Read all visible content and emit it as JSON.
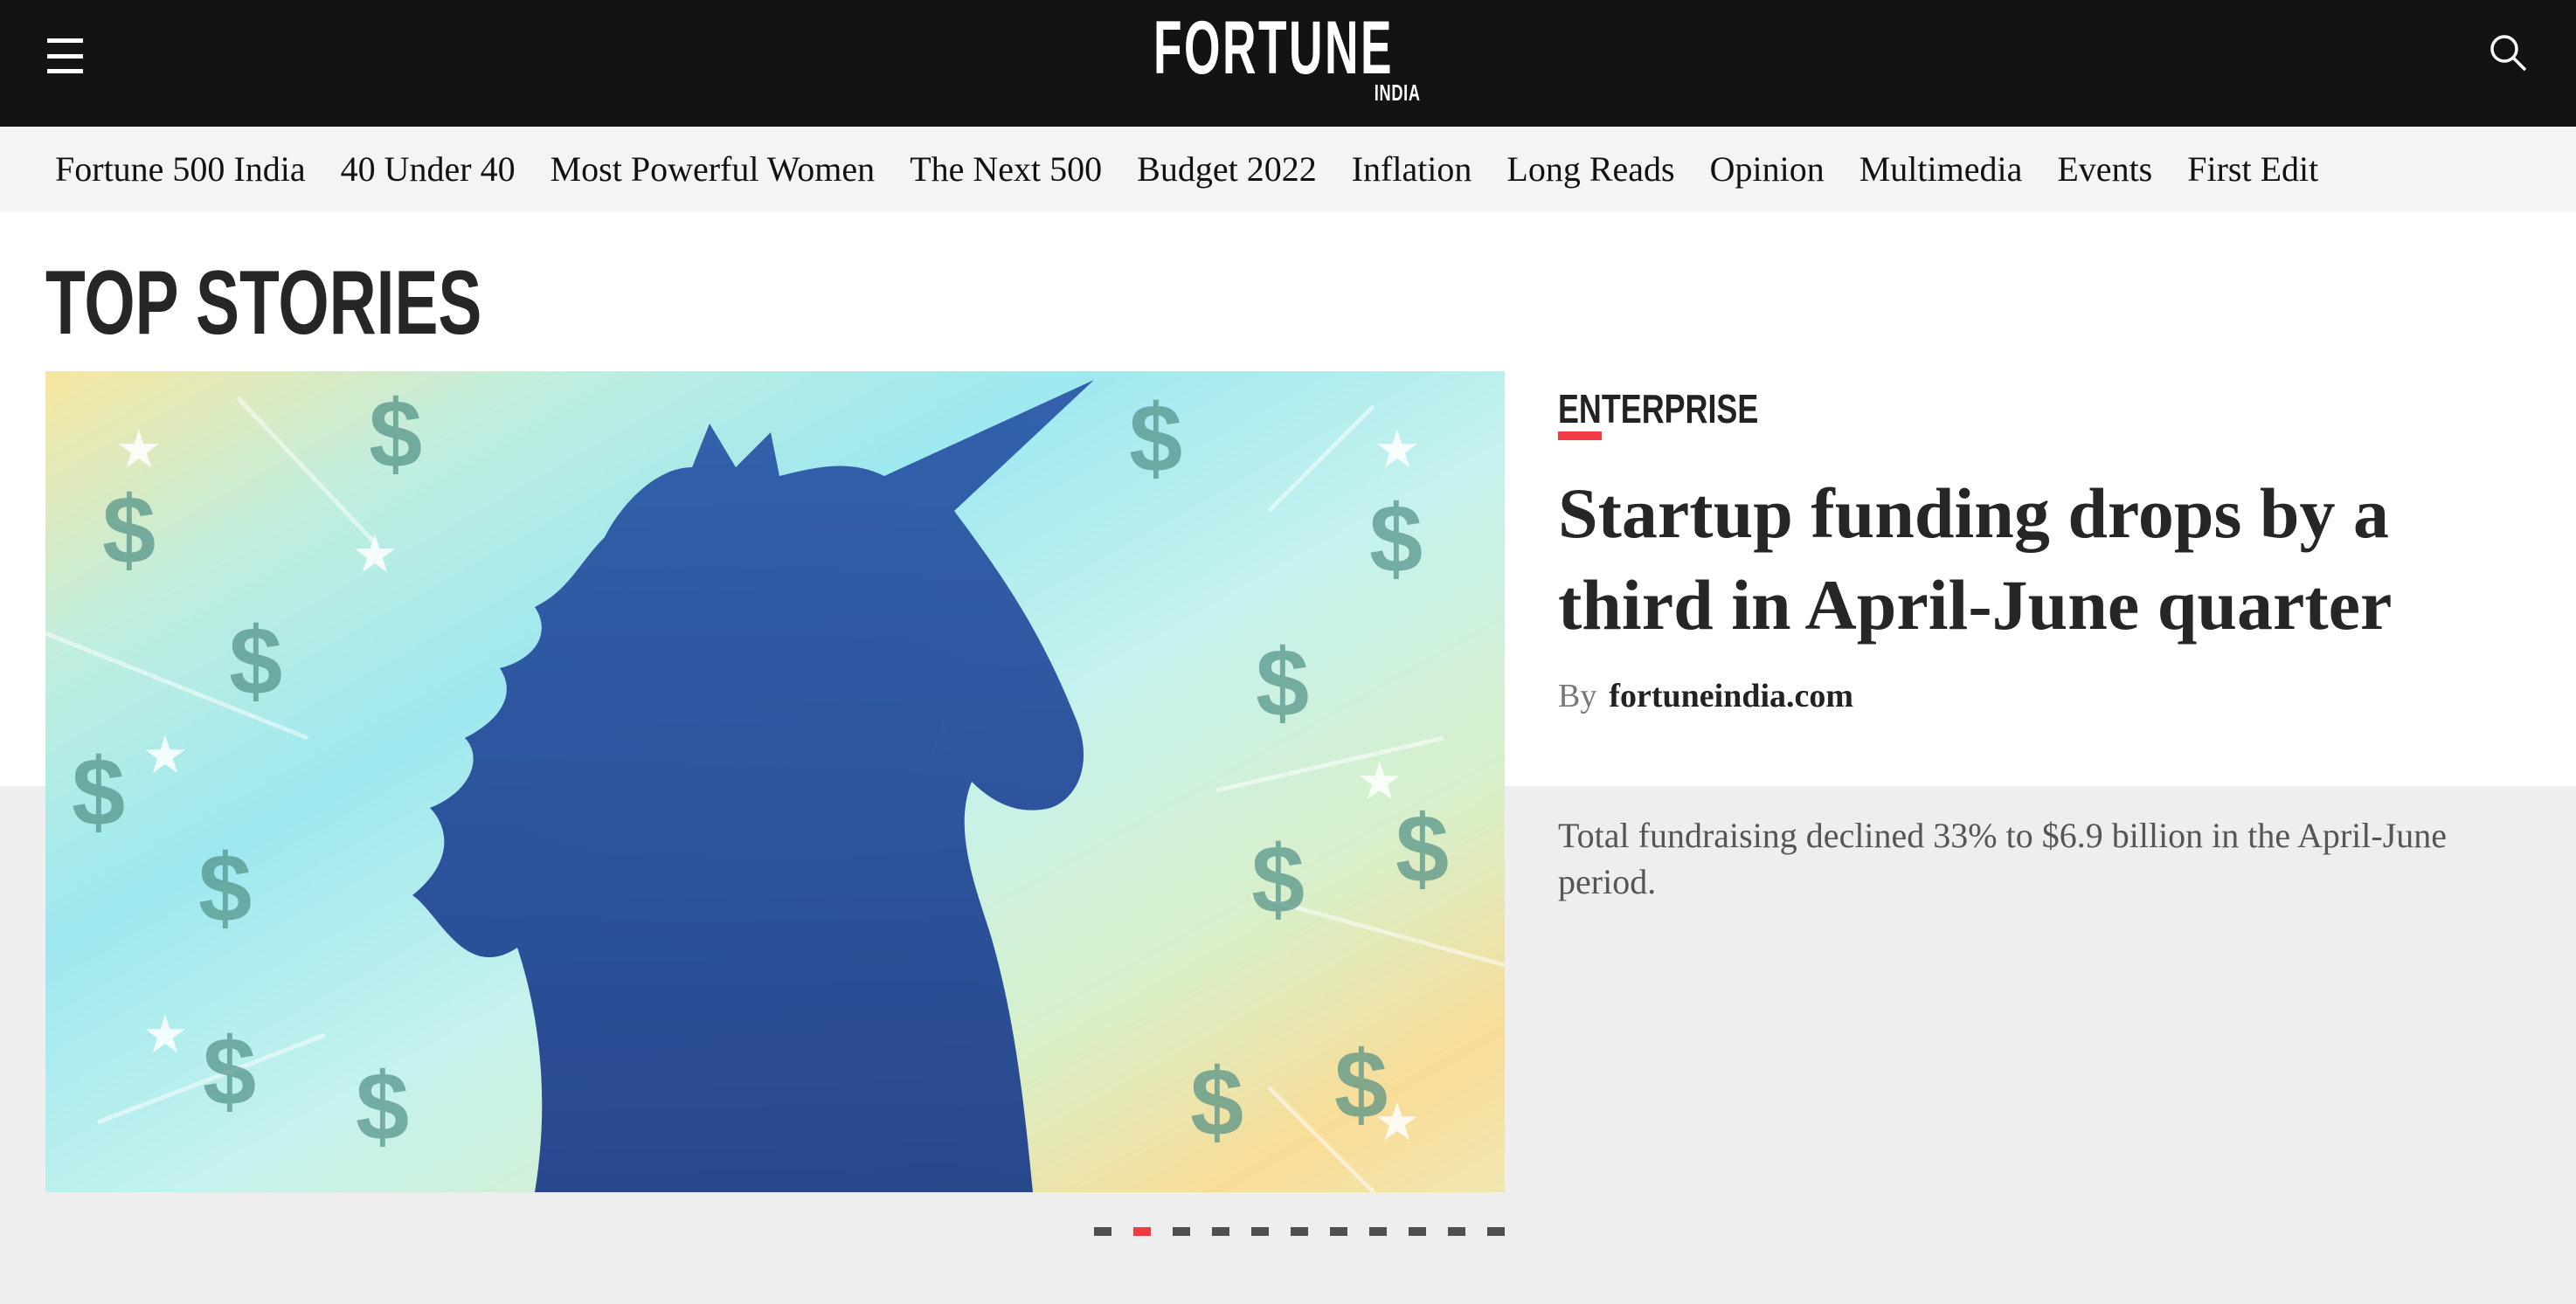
{
  "header": {
    "logo_main": "FORTUNE",
    "logo_sub": "INDIA",
    "menu_icon": "hamburger-menu-icon",
    "search_icon": "search-icon",
    "background_color": "#131313"
  },
  "nav": {
    "items": [
      {
        "label": "Fortune 500 India"
      },
      {
        "label": "40 Under 40"
      },
      {
        "label": "Most Powerful Women"
      },
      {
        "label": "The Next 500"
      },
      {
        "label": "Budget 2022"
      },
      {
        "label": "Inflation"
      },
      {
        "label": "Long Reads"
      },
      {
        "label": "Opinion"
      },
      {
        "label": "Multimedia"
      },
      {
        "label": "Events"
      },
      {
        "label": "First Edit"
      }
    ]
  },
  "top_stories": {
    "title": "TOP STORIES",
    "featured": {
      "category": "ENTERPRISE",
      "headline": "Startup funding drops by a third in April-June quarter",
      "by_label": "By",
      "author": "fortuneindia.com",
      "summary": "Total fundraising declined 33% to $6.9 billion in the April-June period.",
      "image_alt": "Blue unicorn silhouette with dollar signs and stars on a pastel background"
    },
    "carousel": {
      "total_slides": 11,
      "active_index": 1
    }
  },
  "colors": {
    "accent": "#f03c44",
    "text_dark": "#262626",
    "nav_bg": "#f4f4f4",
    "page_bg": "#eeeeee"
  }
}
